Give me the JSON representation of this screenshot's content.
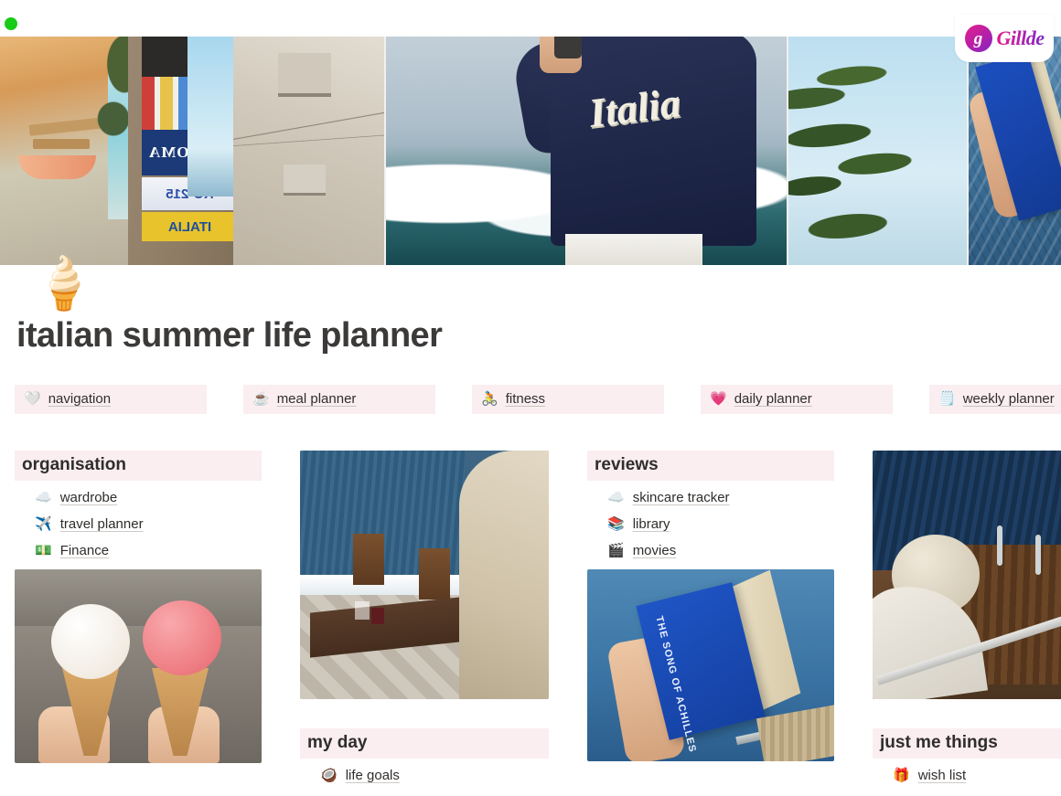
{
  "window": {
    "status_indicator": "recording-dot",
    "status_color": "#17cc17"
  },
  "brand": {
    "mark_letter": "g",
    "name": "Gillde",
    "gradient_from": "#e2188c",
    "gradient_to": "#7a28c6"
  },
  "hero": {
    "panes": [
      {
        "name": "italian-alley-postcards",
        "postcard_love": "I ❤ ROMA",
        "postcard_plate": "RO-215",
        "postcard_italia": "ITALIA",
        "banner_top": "ITALIA"
      },
      {
        "name": "italia-sweatshirt-waves",
        "sweatshirt_text": "Italia"
      },
      {
        "name": "palm-tree-sky"
      },
      {
        "name": "hand-holding-book-at-sea"
      }
    ],
    "overlay_emoji": "🍦"
  },
  "page_title": "italian summer life planner",
  "nav": {
    "items": [
      {
        "emoji": "🤍",
        "icon_name": "white-heart-icon",
        "label": "navigation"
      },
      {
        "emoji": "☕",
        "icon_name": "coffee-icon",
        "label": "meal planner"
      },
      {
        "emoji": "🚴",
        "icon_name": "cyclist-icon",
        "label": "fitness"
      },
      {
        "emoji": "💗",
        "icon_name": "pink-heart-icon",
        "label": "daily planner"
      },
      {
        "emoji": "🗒️",
        "icon_name": "notepad-icon",
        "label": "weekly planner"
      }
    ]
  },
  "columns": [
    {
      "name": "organisation-column",
      "header": "organisation",
      "links": [
        {
          "emoji": "☁️",
          "icon_name": "cloud-icon",
          "label": "wardrobe"
        },
        {
          "emoji": "✈️",
          "icon_name": "airplane-icon",
          "label": "travel planner"
        },
        {
          "emoji": "💵",
          "icon_name": "banknote-icon",
          "label": "Finance"
        }
      ],
      "photo": "two-gelato-cones"
    },
    {
      "name": "my-day-column",
      "header": "my day",
      "links": [
        {
          "emoji": "🥥",
          "icon_name": "coconut-icon",
          "label": "life goals"
        }
      ],
      "photo": "seaside-restaurant-table"
    },
    {
      "name": "reviews-column",
      "header": "reviews",
      "links": [
        {
          "emoji": "☁️",
          "icon_name": "cloud-icon",
          "label": "skincare tracker"
        },
        {
          "emoji": "📚",
          "icon_name": "books-icon",
          "label": "library"
        },
        {
          "emoji": "🎬",
          "icon_name": "clapper-board-icon",
          "label": "movies"
        }
      ],
      "photo": "reading-book-on-boat"
    },
    {
      "name": "just-me-things-column",
      "header": "just me things",
      "links": [
        {
          "emoji": "🎁",
          "icon_name": "gift-icon",
          "label": "wish list"
        }
      ],
      "photo": "boat-deck-ladder"
    }
  ],
  "book_cover_title": "THE SONG OF ACHILLES",
  "theme": {
    "pill_bg": "#faeef1",
    "text": "#2f2e2c",
    "title": "#3b3a38"
  }
}
